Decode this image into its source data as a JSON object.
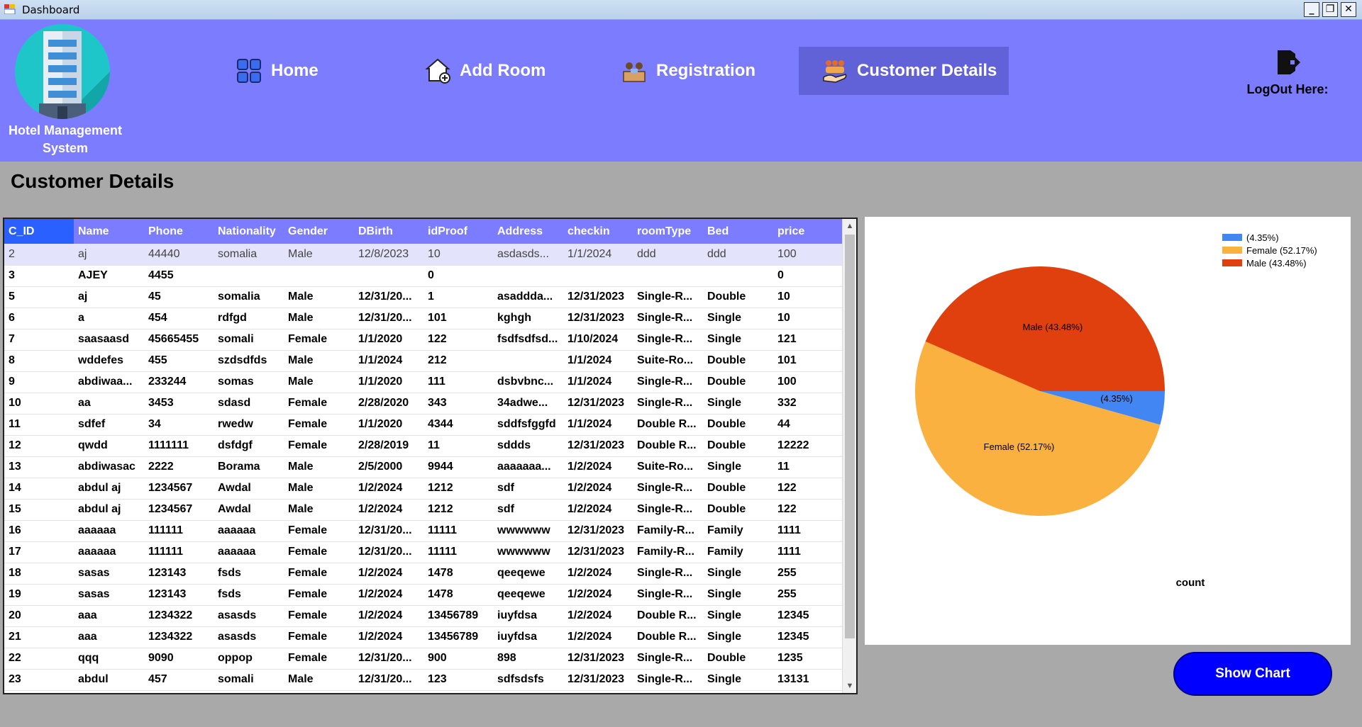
{
  "window": {
    "title": "Dashboard"
  },
  "header": {
    "logo_text_line1": "Hotel Management",
    "logo_text_line2": "System",
    "nav": [
      {
        "label": "Home",
        "icon": "grid-icon"
      },
      {
        "label": "Add Room",
        "icon": "house-add-icon"
      },
      {
        "label": "Registration",
        "icon": "reception-icon"
      },
      {
        "label": "Customer Details",
        "icon": "customers-hand-icon"
      }
    ],
    "logout_label": "LogOut Here:"
  },
  "main": {
    "title": "Customer Details",
    "columns": [
      "C_ID",
      "Name",
      "Phone",
      "Nationality",
      "Gender",
      "DBirth",
      "idProof",
      "Address",
      "checkin",
      "roomType",
      "Bed",
      "price"
    ],
    "rows": [
      [
        "2",
        "aj",
        "44440",
        "somalia",
        "Male",
        "12/8/2023",
        "10",
        "asdasds...",
        "1/1/2024",
        "ddd",
        "ddd",
        "100"
      ],
      [
        "3",
        "AJEY",
        "4455",
        "",
        "",
        "",
        "0",
        "",
        "",
        "",
        "",
        "0"
      ],
      [
        "5",
        "aj",
        "45",
        "somalia",
        "Male",
        "12/31/20...",
        "1",
        "asaddda...",
        "12/31/2023",
        "Single-R...",
        "Double",
        "10"
      ],
      [
        "6",
        "a",
        "454",
        "rdfgd",
        "Male",
        "12/31/20...",
        "101",
        "kghgh",
        "12/31/2023",
        "Single-R...",
        "Single",
        "10"
      ],
      [
        "7",
        "saasaasd",
        "45665455",
        "somali",
        "Female",
        "1/1/2020",
        "122",
        "fsdfsdfsd...",
        "1/10/2024",
        "Single-R...",
        "Single",
        "121"
      ],
      [
        "8",
        "wddefes",
        "455",
        "szdsdfds",
        "Male",
        "1/1/2024",
        "212",
        "",
        "1/1/2024",
        "Suite-Ro...",
        "Double",
        "101"
      ],
      [
        "9",
        "abdiwaa...",
        "233244",
        "somas",
        "Male",
        "1/1/2020",
        "111",
        "dsbvbnc...",
        "1/1/2024",
        "Single-R...",
        "Double",
        "100"
      ],
      [
        "10",
        "aa",
        "3453",
        "sdasd",
        "Female",
        "2/28/2020",
        "343",
        "34adwe...",
        "12/31/2023",
        "Single-R...",
        "Single",
        "332"
      ],
      [
        "11",
        "sdfef",
        "34",
        "rwedw",
        "Female",
        "1/1/2020",
        "4344",
        "sddfsfggfd",
        "1/1/2024",
        "Double R...",
        "Double",
        "44"
      ],
      [
        "12",
        "qwdd",
        "1111111",
        "dsfdgf",
        "Female",
        "2/28/2019",
        "11",
        "sddds",
        "12/31/2023",
        "Double R...",
        "Double",
        "12222"
      ],
      [
        "13",
        "abdiwasac",
        "2222",
        "Borama",
        "Male",
        "2/5/2000",
        "9944",
        "aaaaaaa...",
        "1/2/2024",
        "Suite-Ro...",
        "Single",
        "11"
      ],
      [
        "14",
        "abdul aj",
        "1234567",
        "Awdal",
        "Male",
        "1/2/2024",
        "1212",
        "sdf",
        "1/2/2024",
        "Single-R...",
        "Double",
        "122"
      ],
      [
        "15",
        "abdul aj",
        "1234567",
        "Awdal",
        "Male",
        "1/2/2024",
        "1212",
        "sdf",
        "1/2/2024",
        "Single-R...",
        "Double",
        "122"
      ],
      [
        "16",
        "aaaaaa",
        "111111",
        "aaaaaa",
        "Female",
        "12/31/20...",
        "11111",
        "wwwwww",
        "12/31/2023",
        "Family-R...",
        "Family",
        "1111"
      ],
      [
        "17",
        "aaaaaa",
        "111111",
        "aaaaaa",
        "Female",
        "12/31/20...",
        "11111",
        "wwwwww",
        "12/31/2023",
        "Family-R...",
        "Family",
        "1111"
      ],
      [
        "18",
        "sasas",
        "123143",
        "fsds",
        "Female",
        "1/2/2024",
        "1478",
        "qeeqewe",
        "1/2/2024",
        "Single-R...",
        "Single",
        "255"
      ],
      [
        "19",
        "sasas",
        "123143",
        "fsds",
        "Female",
        "1/2/2024",
        "1478",
        "qeeqewe",
        "1/2/2024",
        "Single-R...",
        "Single",
        "255"
      ],
      [
        "20",
        "aaa",
        "1234322",
        "asasds",
        "Female",
        "1/2/2024",
        "13456789",
        "iuyfdsa",
        "1/2/2024",
        "Double R...",
        "Single",
        "12345"
      ],
      [
        "21",
        "aaa",
        "1234322",
        "asasds",
        "Female",
        "1/2/2024",
        "13456789",
        "iuyfdsa",
        "1/2/2024",
        "Double R...",
        "Single",
        "12345"
      ],
      [
        "22",
        "qqq",
        "9090",
        "oppop",
        "Female",
        "12/31/20...",
        "900",
        "898",
        "12/31/2023",
        "Single-R...",
        "Double",
        "1235"
      ],
      [
        "23",
        "abdul",
        "457",
        "somali",
        "Male",
        "12/31/20...",
        "123",
        "sdfsdsfs",
        "12/31/2023",
        "Single-R...",
        "Single",
        "13131"
      ]
    ],
    "show_chart_label": "Show Chart"
  },
  "chart_data": {
    "type": "pie",
    "title": "",
    "xlabel": "count",
    "legend_position": "top-right",
    "slices": [
      {
        "name": "",
        "label": "(4.35%)",
        "value": 4.35,
        "color": "#4286f4"
      },
      {
        "name": "Female",
        "label": "Female (52.17%)",
        "value": 52.17,
        "color": "#fab13f"
      },
      {
        "name": "Male",
        "label": "Male (43.48%)",
        "value": 43.48,
        "color": "#e0400d"
      }
    ]
  }
}
